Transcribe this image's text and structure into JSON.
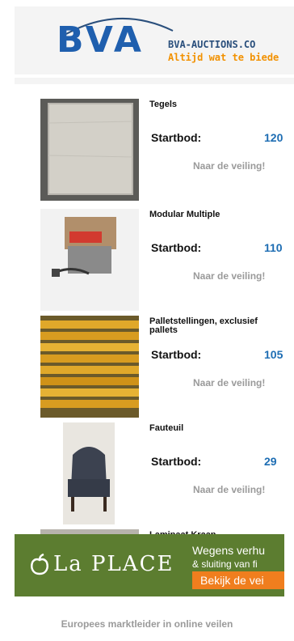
{
  "header": {
    "logo": "BVA",
    "brand": "BVA-AUCTIONS.CO",
    "slogan": "Altijd wat te biede"
  },
  "listings": [
    {
      "title": "Tegels",
      "price_label": "Startbod:",
      "price": "120",
      "link": "Naar de veiling!"
    },
    {
      "title": "Modular Multiple",
      "price_label": "Startbod:",
      "price": "110",
      "link": "Naar de veiling!"
    },
    {
      "title": "Palletstellingen, exclusief pallets",
      "price_label": "Startbod:",
      "price": "105",
      "link": "Naar de veiling!"
    },
    {
      "title": "Fauteuil",
      "price_label": "Startbod:",
      "price": "29",
      "link": "Naar de veiling!"
    },
    {
      "title": "Laminaat Kraan"
    }
  ],
  "ad": {
    "brand": "La PLACE",
    "line1": "Wegens verhu",
    "line2": "& sluiting van fi",
    "cta": "Bekijk de vei"
  },
  "footer": {
    "text": "Europees marktleider in online veilen"
  },
  "colors": {
    "brand_blue": "#1f5fae",
    "accent_orange": "#f29100",
    "price_blue": "#1d6db3",
    "ad_green": "#5c7d30"
  }
}
